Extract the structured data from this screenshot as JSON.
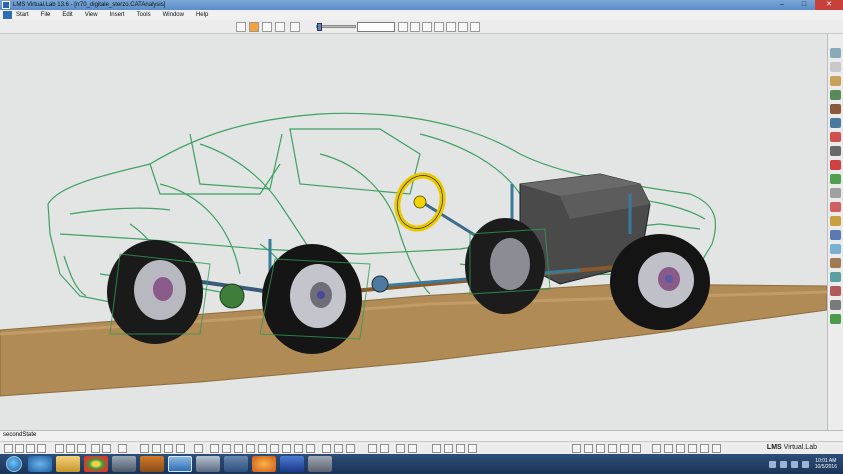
{
  "window": {
    "title": "LMS Virtual.Lab 13.6 - [rr70_digitale_sterzo.CATAnalysis]"
  },
  "menu": {
    "items": [
      "Start",
      "File",
      "Edit",
      "View",
      "Insert",
      "Tools",
      "Window",
      "Help"
    ]
  },
  "toolbar": {
    "time_field": ""
  },
  "status": {
    "text": "secondState"
  },
  "brand": {
    "name": "LMS",
    "suffix": " Virtual.Lab"
  },
  "taskbar": {
    "time": "10:01 AM",
    "date": "10/5/2016",
    "apps": [
      "internet-explorer-icon",
      "folder-icon",
      "chrome-icon",
      "network-icon",
      "media-icon",
      "virtual-lab-icon",
      "app-icon",
      "monitor-icon",
      "firefox-icon",
      "word-icon",
      "calculator-icon"
    ]
  },
  "colors": {
    "wireframe": "#2e9a55",
    "road": "#b08b55",
    "steering_wheel": "#f2d500",
    "engine": "#4a4a4a"
  }
}
